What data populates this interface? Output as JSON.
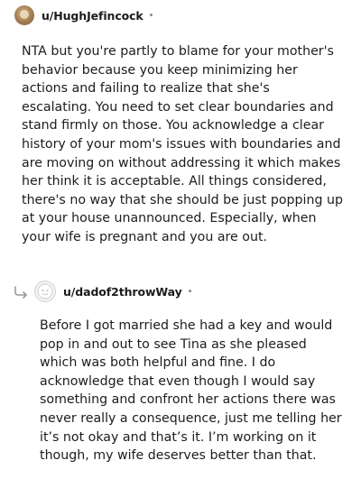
{
  "comments": [
    {
      "username": "u/HughJefincock",
      "separator": "•",
      "body": "NTA but you're partly to blame for your mother's behavior because you keep minimizing her actions and failing to realize that she's escalating. You need to set clear boundaries and stand firmly on those. You acknowledge a clear history of your mom's issues with boundaries and are moving on without addressing it which makes her think it is acceptable. All things considered, there's no way that she should be just popping up at your house unannounced. Especially, when your wife is pregnant and you are out."
    },
    {
      "username": "u/dadof2throwWay",
      "separator": "•",
      "body": "Before I got married she had a key and would pop in and out to see Tina as she pleased which was both helpful and fine. I do acknowledge that even though I would say something and confront her actions there was never really a consequence, just me telling her it’s not okay and that’s it. I’m working on it though, my wife deserves better than that."
    }
  ]
}
